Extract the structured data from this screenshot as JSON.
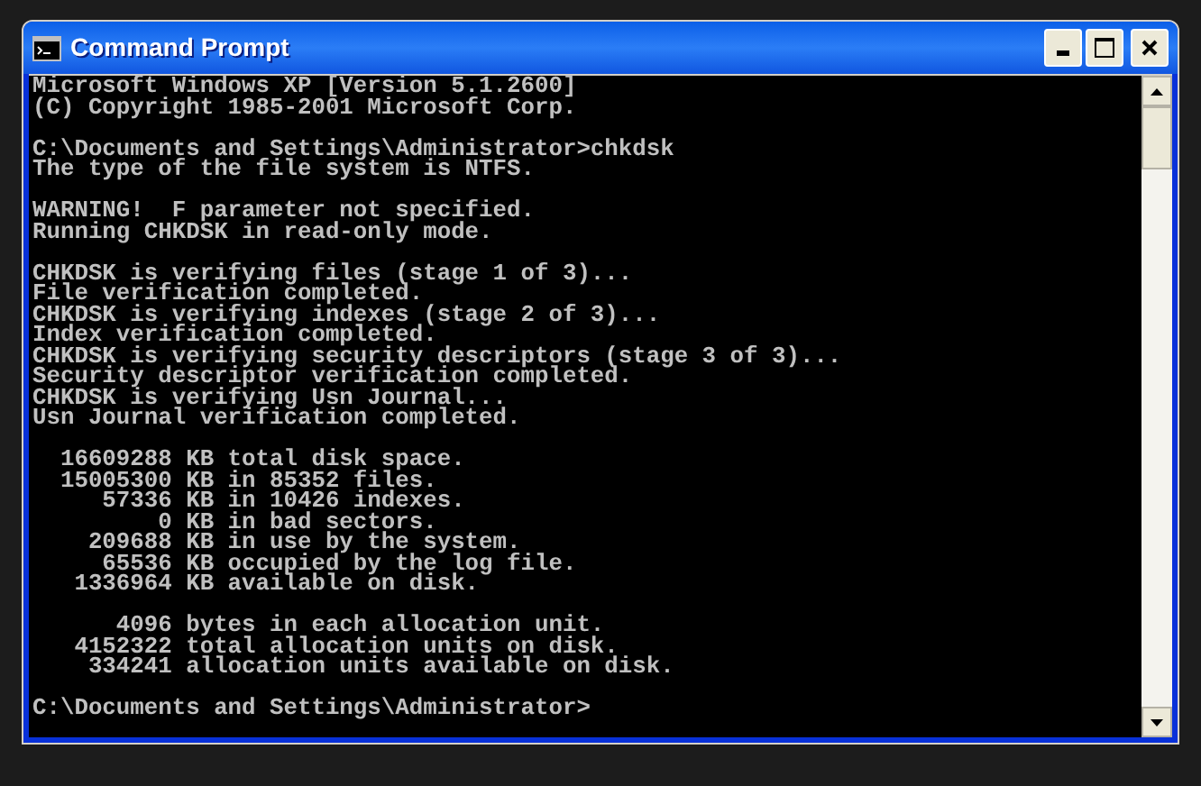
{
  "window": {
    "title": "Command Prompt"
  },
  "console": {
    "blocks": [
      [
        "Microsoft Windows XP [Version 5.1.2600]",
        "(C) Copyright 1985-2001 Microsoft Corp."
      ],
      [
        "C:\\Documents and Settings\\Administrator>chkdsk",
        "The type of the file system is NTFS."
      ],
      [
        "WARNING!  F parameter not specified.",
        "Running CHKDSK in read-only mode."
      ],
      [
        "CHKDSK is verifying files (stage 1 of 3)...",
        "File verification completed.",
        "CHKDSK is verifying indexes (stage 2 of 3)...",
        "Index verification completed.",
        "CHKDSK is verifying security descriptors (stage 3 of 3)...",
        "Security descriptor verification completed.",
        "CHKDSK is verifying Usn Journal...",
        "Usn Journal verification completed."
      ],
      [
        "  16609288 KB total disk space.",
        "  15005300 KB in 85352 files.",
        "     57336 KB in 10426 indexes.",
        "         0 KB in bad sectors.",
        "    209688 KB in use by the system.",
        "     65536 KB occupied by the log file.",
        "   1336964 KB available on disk."
      ],
      [
        "      4096 bytes in each allocation unit.",
        "   4152322 total allocation units on disk.",
        "    334241 allocation units available on disk."
      ],
      [
        "C:\\Documents and Settings\\Administrator>"
      ]
    ]
  }
}
